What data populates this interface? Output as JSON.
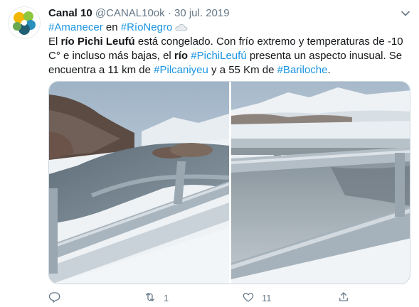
{
  "author": {
    "display_name": "Canal 10",
    "handle": "@CANAL10ok",
    "separator": "·",
    "date": "30 jul. 2019"
  },
  "text": {
    "line1_hashtag1": "#Amanecer",
    "line1_en": " en ",
    "line1_hashtag2": "#RíoNegro",
    "p1": "El ",
    "p1_bold": "río Pichi Leufú",
    "p2": " está congelado. Con frío extremo y temperaturas de -10 C° e incluso más bajas, el ",
    "p2_bold": "río",
    "p3": "  ",
    "hashtag_pichi": "#PichiLeufú",
    "p4": " presenta un aspecto inusual. Se encuentra a 11 km de ",
    "hashtag_pilca": "#Pilcaniyeu",
    "p5": " y a 55 Km de ",
    "hashtag_bari": "#Bariloche",
    "p6": "."
  },
  "actions": {
    "reply_count": "",
    "retweet_count": "1",
    "like_count": "11"
  },
  "colors": {
    "link": "#1b95e0",
    "secondary": "#657786",
    "primary_text": "#14171a"
  },
  "icons": [
    "caret-down-icon",
    "cloud-emoji-icon",
    "reply-icon",
    "retweet-icon",
    "like-icon",
    "share-icon"
  ]
}
